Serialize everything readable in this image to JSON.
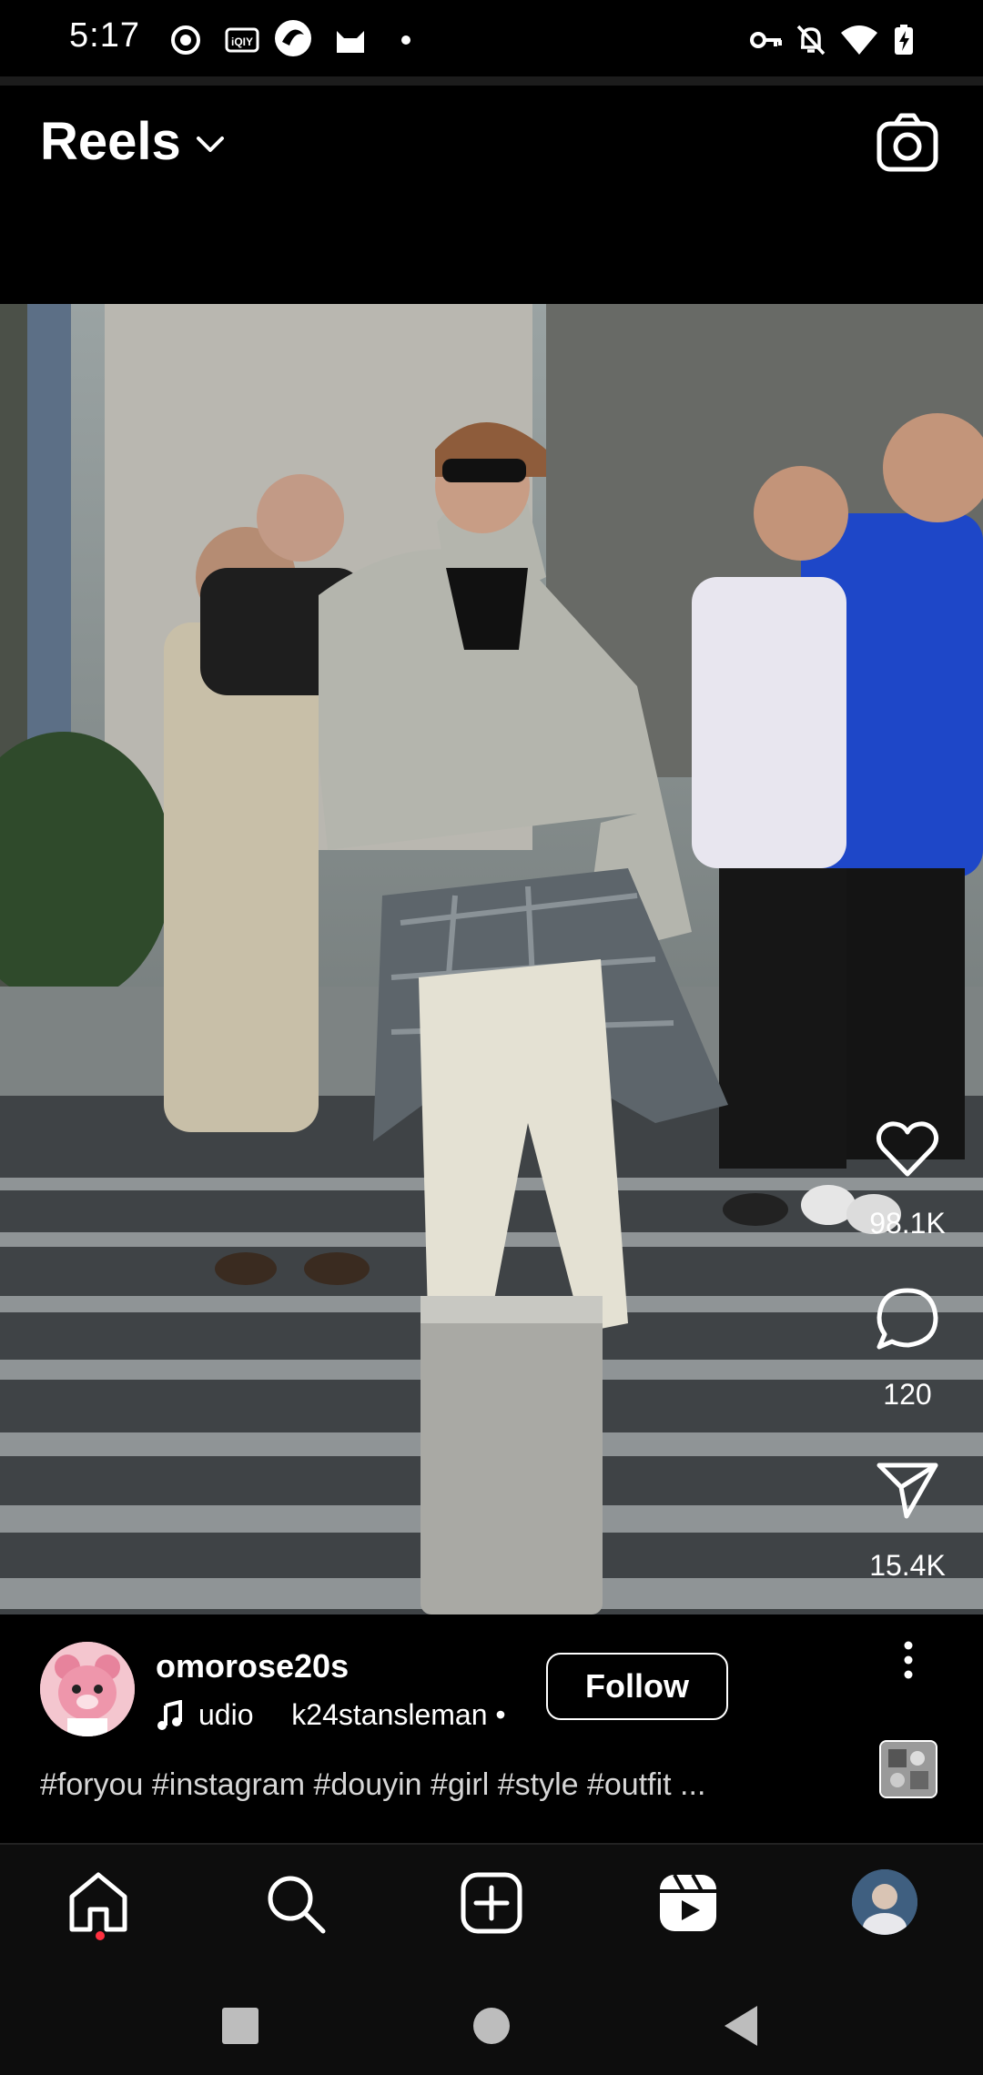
{
  "status_bar": {
    "time": "5:17",
    "left_icons": [
      "record-icon",
      "iqiyi-icon",
      "app-icon",
      "cat-app-icon",
      "dot-icon"
    ],
    "right_icons": [
      "vpn-key-icon",
      "bell-off-icon",
      "wifi-icon",
      "battery-charging-icon"
    ]
  },
  "header": {
    "title": "Reels",
    "dropdown_icon": "chevron-down-icon",
    "camera_icon": "camera-icon"
  },
  "actions": {
    "like_count": "98.1K",
    "comment_count": "120",
    "share_count": "15.4K"
  },
  "post": {
    "username": "omorose20s",
    "audio_prefix": "udio",
    "audio_name": "k24stansleman •",
    "follow_label": "Follow",
    "caption": "#foryou #instagram #douyin #girl #style #outfit ..."
  },
  "nav": {
    "items": [
      "home-icon",
      "search-icon",
      "create-icon",
      "reels-icon",
      "profile-avatar"
    ]
  },
  "system_nav": [
    "recents-button",
    "home-button",
    "back-button"
  ],
  "colors": {
    "background": "#000000",
    "notification_dot": "#ff3040",
    "text_secondary": "#d6d6d6"
  }
}
